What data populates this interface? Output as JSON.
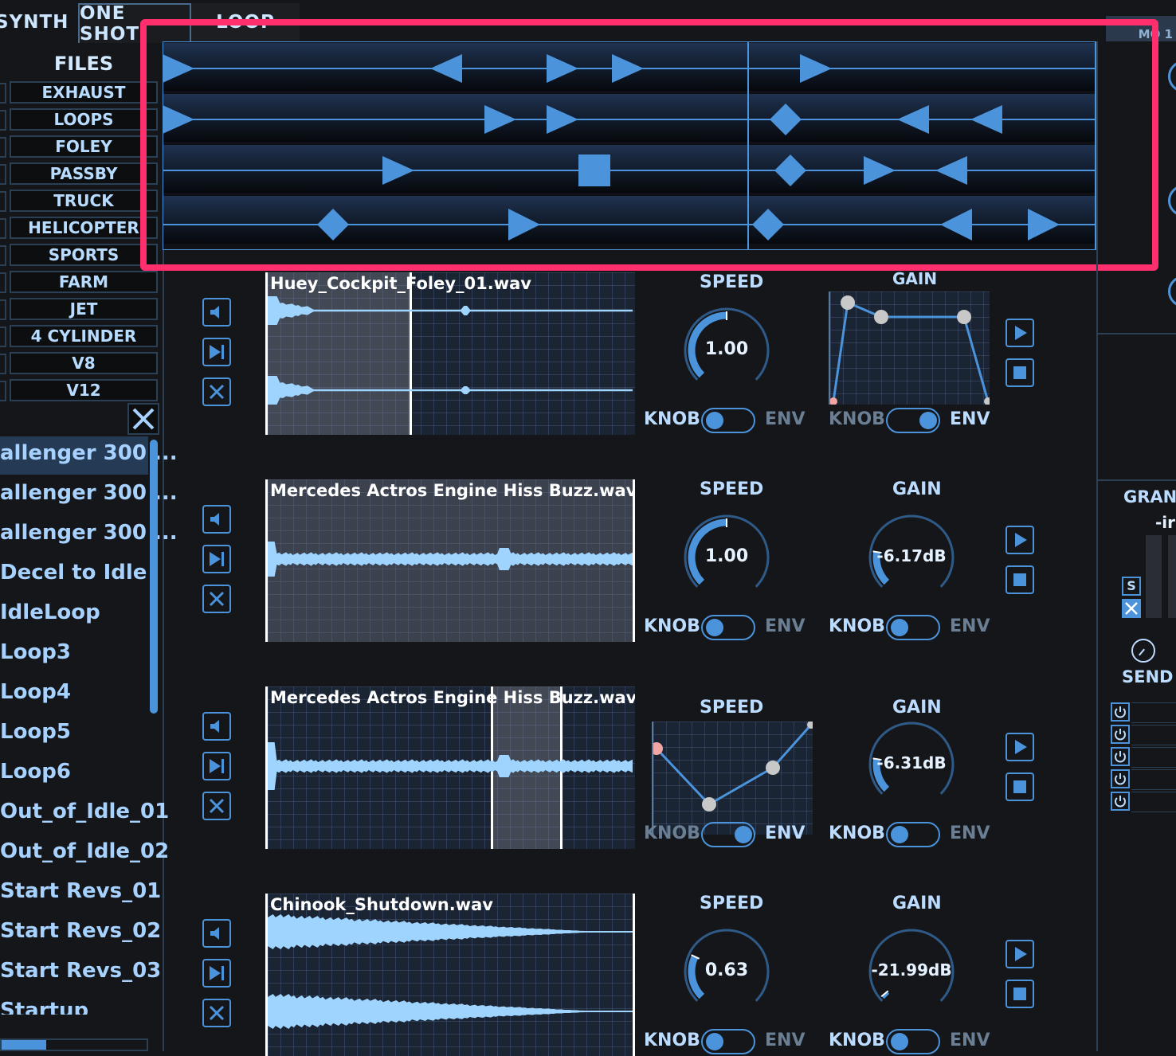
{
  "tabs": [
    {
      "label": "SYNTH"
    },
    {
      "label": "ONE SHOT"
    },
    {
      "label": "LOOP"
    }
  ],
  "top_right_fragment": "MO  1",
  "files_header": "FILES",
  "categories": [
    "EXHAUST",
    "LOOPS",
    "FOLEY",
    "PASSBY",
    "TRUCK",
    "HELICOPTER",
    "SPORTS",
    "FARM",
    "JET",
    "4 CYLINDER",
    "V8",
    "V12"
  ],
  "close_icon": "close-x-icon",
  "file_list": [
    "allenger 300 ...",
    "allenger 300 ...",
    "allenger 300 ...",
    "Decel to Idle",
    "IdleLoop",
    "Loop3",
    "Loop4",
    "Loop5",
    "Loop6",
    "Out_of_Idle_01",
    "Out_of_Idle_02",
    "Start Revs_01",
    "Start Revs_02",
    "Start Revs_03",
    "Startup"
  ],
  "sequencer": {
    "highlight_color": "#ff2f6d",
    "track_color": "#4b94dc"
  },
  "slots": [
    {
      "filename": "Huey_Cockpit_Foley_01.wav",
      "speed_label": "SPEED",
      "gain_label": "GAIN",
      "speed_value": "1.00",
      "gain_value": "",
      "speed_mode": "KNOB",
      "gain_mode": "ENV",
      "knob_label": "KNOB",
      "env_label": "ENV"
    },
    {
      "filename": "Mercedes Actros Engine Hiss Buzz.wav",
      "speed_label": "SPEED",
      "gain_label": "GAIN",
      "speed_value": "1.00",
      "gain_value": "-6.17dB",
      "speed_mode": "KNOB",
      "gain_mode": "KNOB",
      "knob_label": "KNOB",
      "env_label": "ENV"
    },
    {
      "filename": "Mercedes Actros Engine Hiss Buzz.wav",
      "speed_label": "SPEED",
      "gain_label": "GAIN",
      "speed_value": "",
      "gain_value": "-6.31dB",
      "speed_mode": "ENV",
      "gain_mode": "KNOB",
      "knob_label": "KNOB",
      "env_label": "ENV"
    },
    {
      "filename": "Chinook_Shutdown.wav",
      "speed_label": "SPEED",
      "gain_label": "GAIN",
      "speed_value": "0.63",
      "gain_value": "-21.99dB",
      "speed_mode": "KNOB",
      "gain_mode": "KNOB",
      "knob_label": "KNOB",
      "env_label": "ENV"
    }
  ],
  "right_panel": {
    "gran_label": "GRANU",
    "in_label": "-ir",
    "s_label": "S",
    "send_label": "SEND"
  }
}
